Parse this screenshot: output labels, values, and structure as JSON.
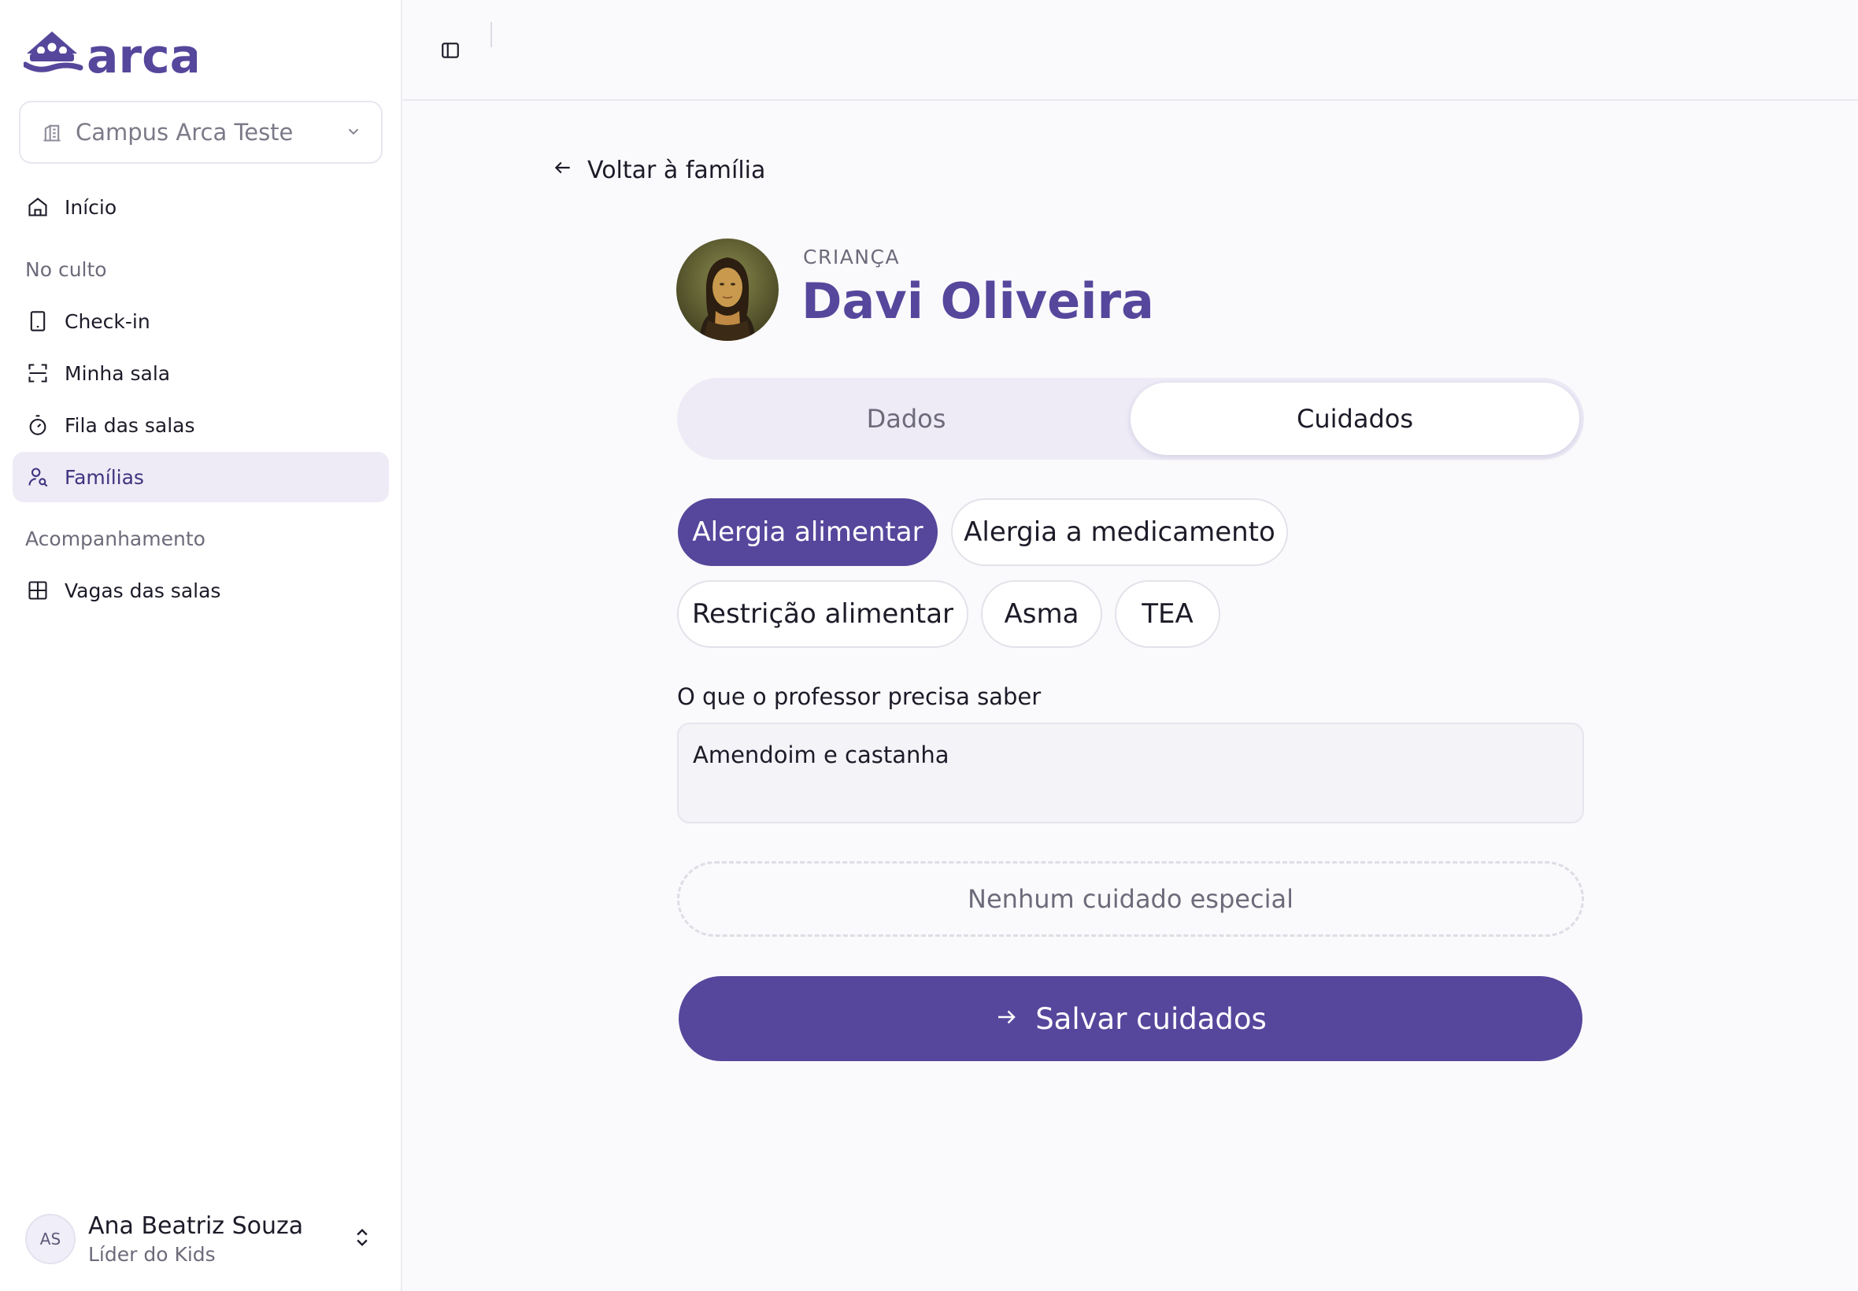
{
  "app": {
    "logo_text": "arca",
    "brand_color": "#56479c"
  },
  "sidebar": {
    "campus": {
      "label": "Campus Arca Teste",
      "icon": "building-icon"
    },
    "items": [
      {
        "label": "Início",
        "icon": "home-icon",
        "active": false
      },
      {
        "section": "No culto"
      },
      {
        "label": "Check-in",
        "icon": "tablet-icon",
        "active": false
      },
      {
        "label": "Minha sala",
        "icon": "scan-icon",
        "active": false
      },
      {
        "label": "Fila das salas",
        "icon": "timer-icon",
        "active": false
      },
      {
        "label": "Famílias",
        "icon": "user-search-icon",
        "active": true
      },
      {
        "section": "Acompanhamento"
      },
      {
        "label": "Vagas das salas",
        "icon": "grid-icon",
        "active": false
      }
    ],
    "user": {
      "initials": "AS",
      "name": "Ana Beatriz Souza",
      "role": "Líder do Kids"
    }
  },
  "main": {
    "back_link": "Voltar à família",
    "kind": "CRIANÇA",
    "child_name": "Davi Oliveira",
    "tabs": [
      {
        "label": "Dados",
        "active": false
      },
      {
        "label": "Cuidados",
        "active": true
      }
    ],
    "care_chips": [
      {
        "label": "Alergia alimentar",
        "selected": true
      },
      {
        "label": "Alergia a medicamento",
        "selected": false
      },
      {
        "label": "Restrição alimentar",
        "selected": false
      },
      {
        "label": "Asma",
        "selected": false
      },
      {
        "label": "TEA",
        "selected": false
      }
    ],
    "notes_label": "O que o professor precisa saber",
    "notes_value": "Amendoim e castanha",
    "no_care_label": "Nenhum cuidado especial",
    "save_label": "Salvar cuidados"
  }
}
